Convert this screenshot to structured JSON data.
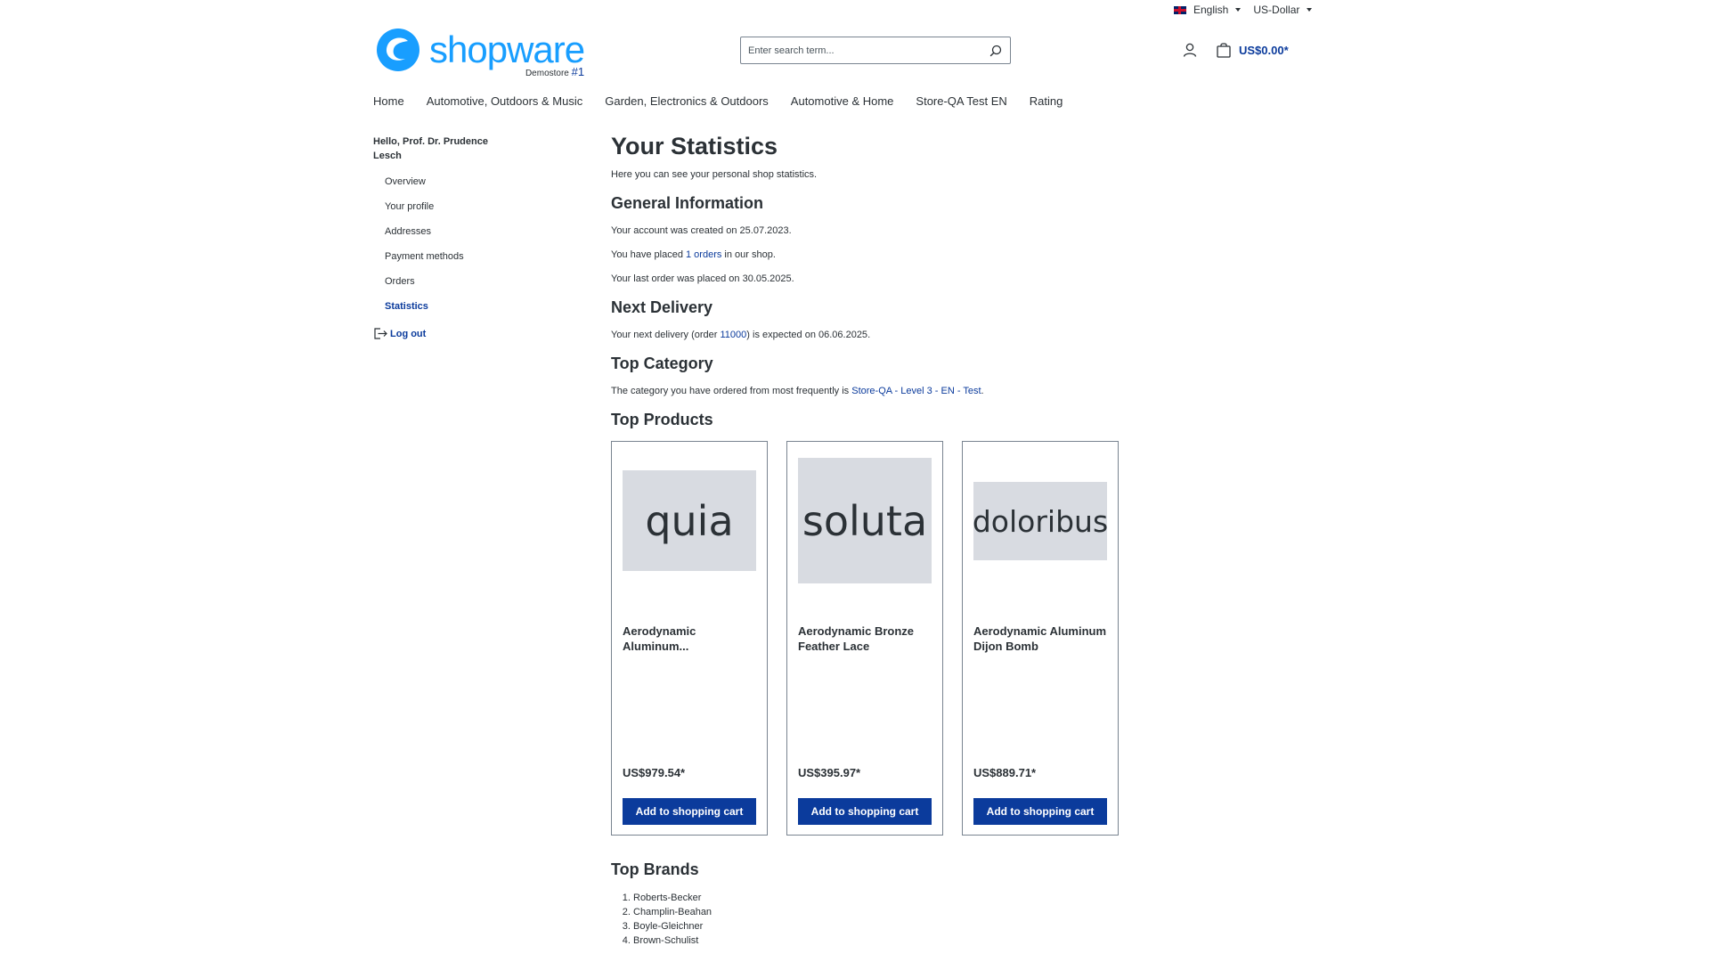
{
  "topbar": {
    "language": "English",
    "currency": "US-Dollar"
  },
  "header": {
    "logo_text": "shopware",
    "logo_sub": "Demostore",
    "logo_badge": "#1",
    "search_placeholder": "Enter search term...",
    "cart_total": "US$0.00*"
  },
  "nav": [
    {
      "label": "Home"
    },
    {
      "label": "Automotive, Outdoors & Music"
    },
    {
      "label": "Garden, Electronics & Outdoors"
    },
    {
      "label": "Automotive & Home"
    },
    {
      "label": "Store-QA Test EN"
    },
    {
      "label": "Rating"
    }
  ],
  "sidebar": {
    "greeting": "Hello, Prof. Dr. Prudence Lesch",
    "items": [
      {
        "label": "Overview"
      },
      {
        "label": "Your profile"
      },
      {
        "label": "Addresses"
      },
      {
        "label": "Payment methods"
      },
      {
        "label": "Orders"
      },
      {
        "label": "Statistics"
      }
    ],
    "logout": "Log out"
  },
  "main": {
    "title": "Your Statistics",
    "intro": "Here you can see your personal shop statistics.",
    "general": {
      "heading": "General Information",
      "created_pre": "Your account was created on ",
      "created_date": "25.07.2023",
      "placed_pre": "You have placed ",
      "placed_link": "1 orders",
      "placed_post": " in our shop.",
      "last_pre": "Your last order was placed on ",
      "last_date": "30.05.2025"
    },
    "delivery": {
      "heading": "Next Delivery",
      "pre": "Your next delivery (order ",
      "order_link": "11000",
      "mid": ") is expected on ",
      "date": "06.06.2025"
    },
    "category": {
      "heading": "Top Category",
      "pre": "The category you have ordered from most frequently is ",
      "link": "Store-QA - Level 3 - EN - Test"
    },
    "products_heading": "Top Products",
    "products": [
      {
        "image_text": "quia",
        "name": "Aerodynamic Aluminum...",
        "price": "US$979.54*",
        "button": "Add to shopping cart"
      },
      {
        "image_text": "soluta",
        "name": "Aerodynamic Bronze Feather Lace",
        "price": "US$395.97*",
        "button": "Add to shopping cart"
      },
      {
        "image_text": "doloribus",
        "name": "Aerodynamic Aluminum Dijon Bomb",
        "price": "US$889.71*",
        "button": "Add to shopping cart"
      }
    ],
    "brands_heading": "Top Brands",
    "brands": [
      "Roberts-Becker",
      "Champlin-Beahan",
      "Boyle-Gleichner",
      "Brown-Schulist"
    ]
  }
}
